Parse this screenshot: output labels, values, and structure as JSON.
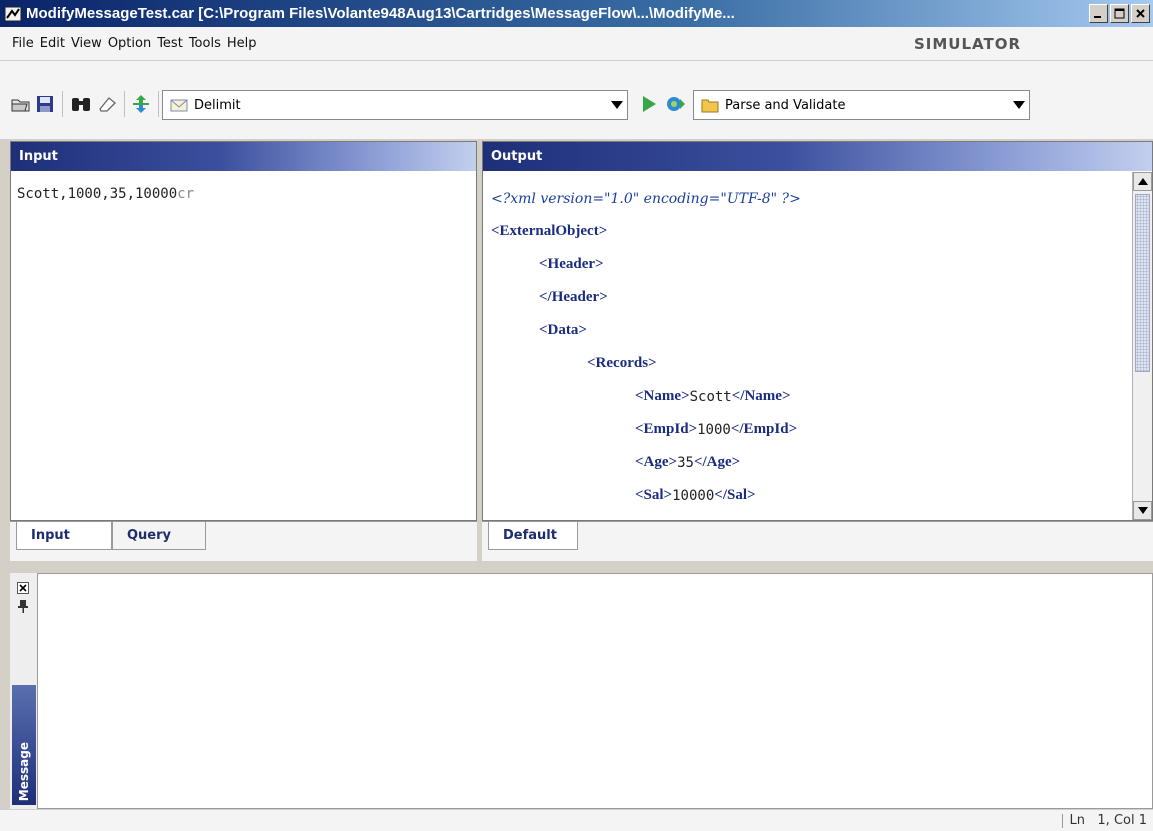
{
  "window": {
    "title": "ModifyMessageTest.car [C:\\Program Files\\Volante948Aug13\\Cartridges\\MessageFlow\\...\\ModifyMe..."
  },
  "menu": {
    "items": [
      "File",
      "Edit",
      "View",
      "Option",
      "Test",
      "Tools",
      "Help"
    ],
    "brand": "SIMULATOR"
  },
  "toolbar": {
    "format_combo": "Delimit",
    "action_combo": "Parse and Validate",
    "icons": [
      "open-folder-icon",
      "save-icon",
      "binoculars-icon",
      "eraser-icon",
      "swap-arrows-icon",
      "run-icon",
      "debug-gear-icon"
    ]
  },
  "input_panel": {
    "header": "Input",
    "text": "Scott,1000,35,10000",
    "eol_marker": "cr",
    "tabs": [
      "Input",
      "Query"
    ]
  },
  "output_panel": {
    "header": "Output",
    "lines": [
      {
        "indent": 0,
        "decl": "<?xml version=\"1.0\" encoding=\"UTF-8\" ?>"
      },
      {
        "indent": 0,
        "open": "<ExternalObject>"
      },
      {
        "indent": 1,
        "open": "<Header>"
      },
      {
        "indent": 1,
        "open": "</Header>"
      },
      {
        "indent": 1,
        "open": "<Data>"
      },
      {
        "indent": 2,
        "open": "<Records>"
      },
      {
        "indent": 3,
        "open": "<Name>",
        "text": "Scott",
        "close": "</Name>"
      },
      {
        "indent": 3,
        "open": "<EmpId>",
        "text": "1000",
        "close": "</EmpId>"
      },
      {
        "indent": 3,
        "open": "<Age>",
        "text": "35",
        "close": "</Age>"
      },
      {
        "indent": 3,
        "open": "<Sal>",
        "text": "10000",
        "close": "</Sal>"
      }
    ],
    "tabs": [
      "Default"
    ]
  },
  "message_panel": {
    "label": "Message"
  },
  "status": {
    "position": "Ln   1, Col 1"
  }
}
